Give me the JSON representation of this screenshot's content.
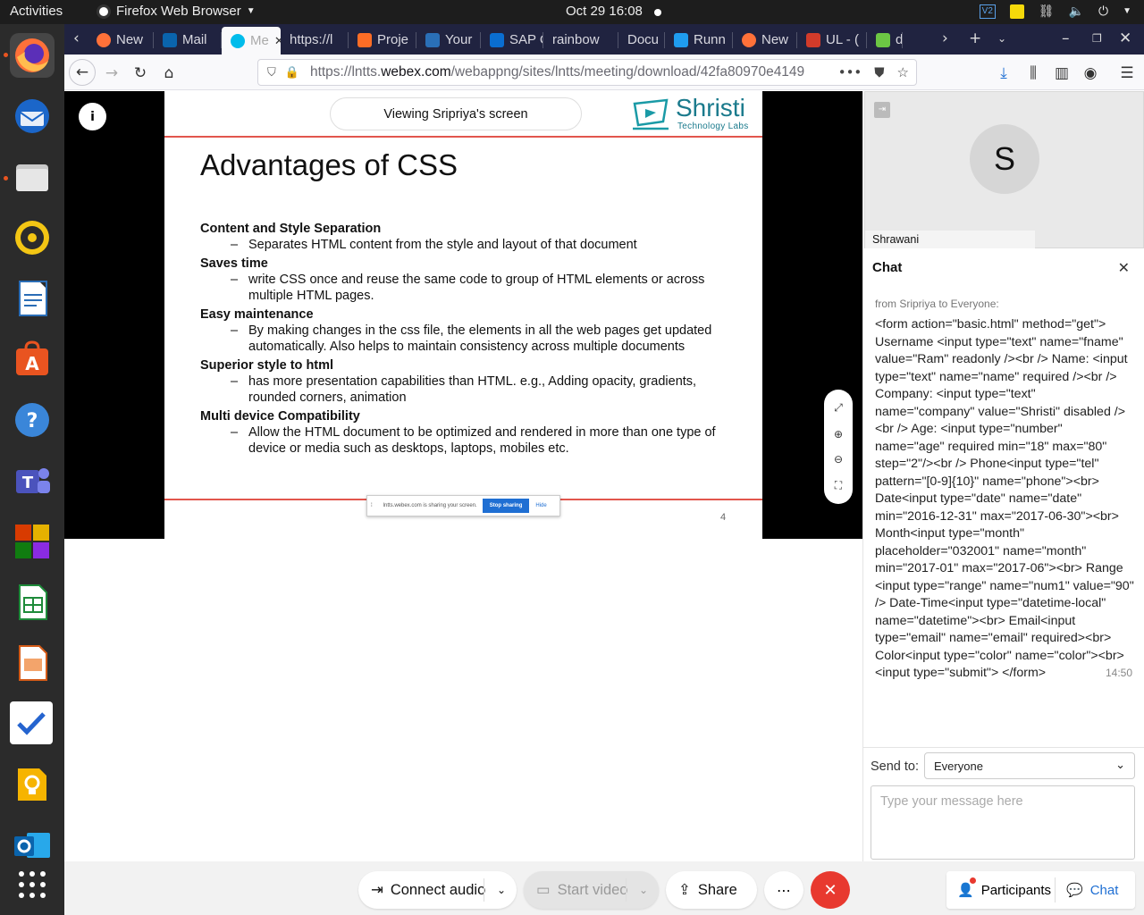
{
  "topbar": {
    "activities": "Activities",
    "app_name": "Firefox Web Browser",
    "clock": "Oct 29  16:08",
    "tray_vs": "V2"
  },
  "tabs": [
    {
      "label": "New",
      "icon": "firefox-icon",
      "color": "#ff7139"
    },
    {
      "label": "Mail",
      "icon": "outlook-icon",
      "color": "#0a64ad"
    },
    {
      "label": "Me",
      "icon": "webex-icon",
      "color": "#00bceb",
      "active": true
    },
    {
      "label": "https://l",
      "icon": "",
      "color": ""
    },
    {
      "label": "Proje",
      "icon": "gitlab-icon",
      "color": "#fc6d26"
    },
    {
      "label": "Your",
      "icon": "si-icon",
      "color": "#2a6fb7"
    },
    {
      "label": "SAP C",
      "icon": "sap-icon",
      "color": "#0a6ed1"
    },
    {
      "label": "rainbow",
      "icon": "",
      "color": ""
    },
    {
      "label": "Docu",
      "icon": "",
      "color": ""
    },
    {
      "label": "Runn",
      "icon": "vscode-icon",
      "color": "#1f9cf0"
    },
    {
      "label": "New",
      "icon": "firefox-icon",
      "color": "#ff7139"
    },
    {
      "label": "UL - (",
      "icon": "ul-icon",
      "color": "#d23b2a"
    },
    {
      "label": "d",
      "icon": "github-icon",
      "color": "#6cc644"
    }
  ],
  "url": {
    "prefix": "https://lntts.",
    "domain": "webex.com",
    "path": "/webappng/sites/lntts/meeting/download/42fa80970e4149"
  },
  "slide": {
    "viewing": "Viewing Sripriya's screen",
    "logo_name": "Shristi",
    "logo_sub": "Technology Labs",
    "title": "Advantages of CSS",
    "sections": [
      {
        "heading": "Content and Style Separation",
        "items": [
          "Separates HTML content from the style and layout of that document"
        ]
      },
      {
        "heading": "Saves time",
        "items": [
          "write CSS once and reuse the same code to group of HTML elements or across multiple HTML pages."
        ]
      },
      {
        "heading": "Easy maintenance",
        "items": [
          "By making changes in the css file, the elements in all the web pages get updated automatically. Also helps to maintain consistency across multiple documents"
        ]
      },
      {
        "heading": "Superior style to html",
        "items": [
          "has more presentation capabilities than HTML. e.g., Adding opacity, gradients, rounded corners, animation"
        ]
      },
      {
        "heading": "Multi device Compatibility",
        "items": [
          "Allow the HTML document to be optimized  and rendered in more than one type of device or media such as desktops, laptops, mobiles etc."
        ]
      }
    ],
    "share_text": "lntts.webex.com is sharing your screen.",
    "stop_sharing": "Stop sharing",
    "hide": "Hide",
    "page_number": "4"
  },
  "participant": {
    "initial": "S",
    "name": "Shrawani"
  },
  "chat": {
    "title": "Chat",
    "from": "from Sripriya to Everyone:",
    "message": "<form action=\"basic.html\" method=\"get\"> Username <input type=\"text\" name=\"fname\" value=\"Ram\" readonly /><br /> Name: <input type=\"text\" name=\"name\" required /><br /> Company: <input type=\"text\" name=\"company\" value=\"Shristi\" disabled /><br /> Age: <input type=\"number\" name=\"age\" required min=\"18\" max=\"80\" step=\"2\"/><br /> Phone<input type=\"tel\" pattern=\"[0-9]{10}\" name=\"phone\"><br> Date<input type=\"date\" name=\"date\" min=\"2016-12-31\" max=\"2017-06-30\"><br> Month<input type=\"month\" placeholder=\"032001\" name=\"month\" min=\"2017-01\" max=\"2017-06\"><br> Range <input type=\"range\" name=\"num1\" value=\"90\" /> Date-Time<input type=\"datetime-local\" name=\"datetime\"><br> Email<input type=\"email\" name=\"email\" required><br> Color<input type=\"color\" name=\"color\"><br> <input type=\"submit\"> </form>",
    "time": "14:50",
    "send_to_label": "Send to:",
    "send_to_value": "Everyone",
    "placeholder": "Type your message here"
  },
  "controls": {
    "connect_audio": "Connect audio",
    "start_video": "Start video",
    "share": "Share",
    "more": "⋯",
    "participants": "Participants",
    "chat": "Chat"
  },
  "colors": {
    "accent": "#1f6fd3",
    "end_call": "#e8392f",
    "slide_rule": "#e2564d",
    "brand_teal": "#1a7a8c"
  }
}
